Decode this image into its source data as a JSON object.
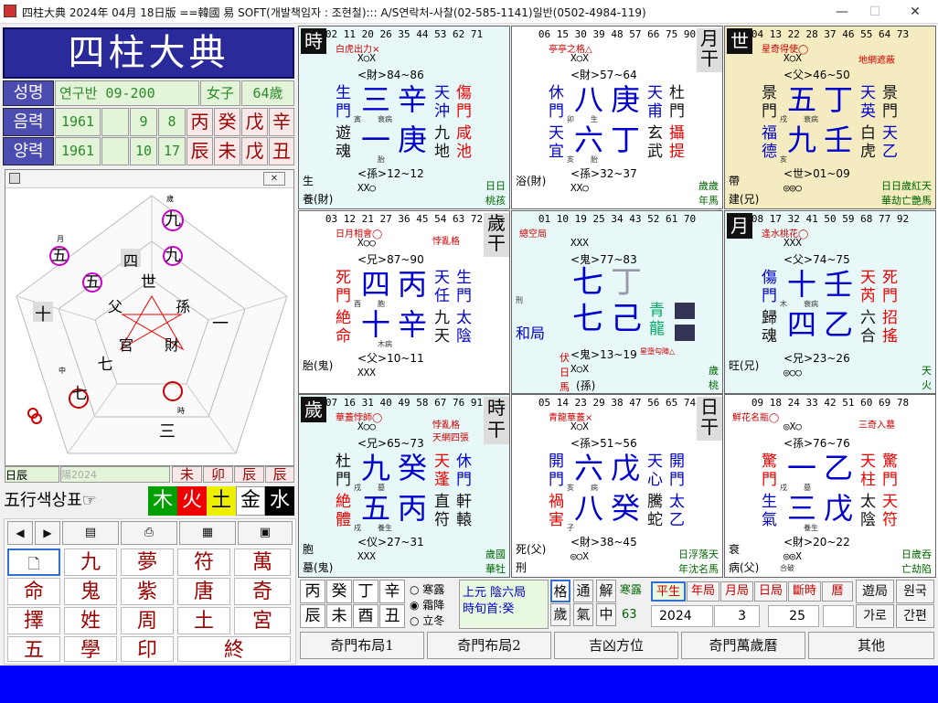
{
  "window": {
    "title": "四柱大典 2024年 04月 18日版 ==韓國 易 SOFT(개발책임자 : 조현철)::: A/S연락처-사찰(02-585-1141)일반(0502-4984-119)",
    "minimize": "—",
    "maximize": "☐",
    "close": "✕"
  },
  "logo": "四柱大典",
  "profile": {
    "name_label": "성명",
    "name": "연구반 09-200",
    "gender": "女子",
    "age": "64歲",
    "lunar_label": "음력",
    "lunar_year": "1961",
    "lunar_m": "9",
    "lunar_d": "8",
    "solar_label": "양력",
    "solar_year": "1961",
    "solar_m": "10",
    "solar_d": "17",
    "stems": [
      "丙",
      "癸",
      "戊",
      "辛"
    ],
    "branches": [
      "辰",
      "未",
      "戊",
      "丑"
    ]
  },
  "chart": {
    "rings": [
      "九",
      "九",
      "五",
      "五",
      "四",
      "十",
      "七",
      "七",
      "三",
      "一"
    ],
    "center": [
      "世",
      "父",
      "孫",
      "官",
      "財"
    ],
    "labels": [
      "歲",
      "月",
      "中",
      "時"
    ],
    "partial_date": "日辰",
    "partial_date2": "陽2024",
    "bottom_branches": [
      "未",
      "卯",
      "辰",
      "辰"
    ]
  },
  "elements": {
    "label": "五行색상표",
    "hand": "☞",
    "items": [
      "木",
      "火",
      "土",
      "金",
      "水"
    ]
  },
  "toolbar": {
    "prev": "◀",
    "next": "▶"
  },
  "grid_buttons": [
    "九",
    "夢",
    "符",
    "萬",
    "命",
    "鬼",
    "紫",
    "唐",
    "奇",
    "擇",
    "姓",
    "周",
    "土",
    "宮",
    "五",
    "學",
    "印",
    "終"
  ],
  "palaces": [
    {
      "tag": "時",
      "top": "02 11 20 26 35 44 53 62 71",
      "sub": "白虎出力×",
      "xo1": "X○X",
      "rel1": "<財>84~86",
      "l1": "生",
      "l2": "門",
      "l3": "遊",
      "l4": "魂",
      "b1": "三",
      "b2": "辛",
      "b3": "一",
      "b4": "庚",
      "t1": "寅",
      "t2": "衰病",
      "t3": "",
      "t4": "胎",
      "r1": "天",
      "r2": "沖",
      "r3": "九",
      "r4": "地",
      "rr1": "傷",
      "rr2": "門",
      "rr3": "咸",
      "rr4": "池",
      "rel2": "<孫>12~12",
      "xo2": "XX○",
      "bl": "生",
      "bl2": "養(財)",
      "br": "日日",
      "br2": "桃孩"
    },
    {
      "tag": "月干",
      "top": "06 15 30 39 48 57 66 75 90",
      "sub": "亭亭之格△",
      "xo1": "X○X",
      "rel1": "<財>57~64",
      "l1": "休",
      "l2": "門",
      "l3": "天",
      "l4": "宜",
      "b1": "八",
      "b2": "庚",
      "b3": "六",
      "b4": "丁",
      "t1": "卯",
      "t2": "生",
      "t3": "亥",
      "t4": "胎",
      "r1": "天",
      "r2": "甫",
      "r3": "玄",
      "r4": "武",
      "rr1": "杜",
      "rr2": "門",
      "rr3": "攝",
      "rr4": "提",
      "rel2": "<孫>32~37",
      "xo2": "XX○",
      "bl": "浴(財)",
      "bl2": "",
      "br": "歲歲",
      "br2": "年馬"
    },
    {
      "tag": "世",
      "top": "04 13 22 28 37 46 55 64 73",
      "sub": "星奇得使◯",
      "sub2": "地網遮蔽",
      "xo1": "X○X",
      "rel1": "<父>46~50",
      "l1": "景",
      "l2": "門",
      "l3": "福",
      "l4": "德",
      "b1": "五",
      "b2": "丁",
      "b3": "九",
      "b4": "壬",
      "t1": "戌",
      "t2": "衰病",
      "t3": "亥",
      "t4": "",
      "r1": "天",
      "r2": "英",
      "r3": "白",
      "r4": "虎",
      "rr1": "景",
      "rr2": "門",
      "rr3": "天",
      "rr4": "乙",
      "rel2": "<世>01~09",
      "xo2": "◎◎○",
      "bl": "帶",
      "bl2": "建(兄)",
      "br": "日日歲紅天",
      "br2": "華劫亡艷馬"
    },
    {
      "tag": "歲干",
      "top": "03 12 21 27 36 45 54 63 72",
      "sub": "日月相會◯",
      "sub2": "悖亂格",
      "xo1": "X○○",
      "rel1": "<兄>87~90",
      "l1": "死",
      "l2": "門",
      "l3": "絶",
      "l4": "命",
      "b1": "四",
      "b2": "丙",
      "b3": "十",
      "b4": "辛",
      "t1": "酉",
      "t2": "胞",
      "t3": "",
      "t4": "木病",
      "r1": "天",
      "r2": "任",
      "r3": "九",
      "r4": "天",
      "rr1": "生",
      "rr2": "門",
      "rr3": "太",
      "rr4": "陰",
      "rel2": "<父>10~11",
      "xo2": "XXX",
      "bl": "胎(鬼)",
      "bl2": "",
      "br": "",
      "br2": ""
    },
    {
      "tag": "",
      "top": "01 10 19 25 34 43 52 61 70",
      "sub": "總空局",
      "xo1": "XXX",
      "rel1": "<鬼>77~83",
      "b1": "七",
      "b2": "丁",
      "b3": "七",
      "b4": "己",
      "l1": "和局",
      "r1": "青",
      "r2": "龍",
      "rel2": "<鬼>13~19",
      "sub3": "星墮勾陣△",
      "xo2": "X○X",
      "bl": "伏日馬",
      "bl2": "(孫)",
      "br": "歲",
      "br2": "桃",
      "side": "刑"
    },
    {
      "tag": "月",
      "top": "08 17 32 41 50 59 68 77 92",
      "sub": "逢水桃花◯",
      "xo1": "XXX",
      "rel1": "<父>74~75",
      "l1": "傷",
      "l2": "門",
      "l3": "歸",
      "l4": "魂",
      "b1": "十",
      "b2": "壬",
      "b3": "四",
      "b4": "乙",
      "t1": "木",
      "t2": "衰病",
      "t3": "",
      "t4": "",
      "r1": "天",
      "r2": "芮",
      "r3": "六",
      "r4": "合",
      "rr1": "死",
      "rr2": "門",
      "rr3": "招",
      "rr4": "搖",
      "rel2": "<兄>23~26",
      "xo2": "◎○○",
      "bl": "旺(兄)",
      "bl2": "",
      "br": "天",
      "br2": "火"
    },
    {
      "tag": "歲",
      "tag2": "時干",
      "top": "07 16 31 40 49 58 67 76 91",
      "sub": "華蓋悖師◯",
      "sub2": "悖亂格",
      "sub3": "天網四張",
      "xo1": "X○○",
      "rel1": "<兄>65~73",
      "l1": "杜",
      "l2": "門",
      "l3": "絶",
      "l4": "體",
      "b1": "九",
      "b2": "癸",
      "b3": "五",
      "b4": "丙",
      "t1": "戌",
      "t2": "墓",
      "t3": "戌",
      "t4": "養生",
      "r1": "天",
      "r2": "蓬",
      "r3": "直",
      "r4": "符",
      "rr1": "休",
      "rr2": "門",
      "rr3": "軒",
      "rr4": "轅",
      "rel2": "<仪>27~31",
      "xo2": "XXX",
      "bl": "胞",
      "bl2": "墓(鬼)",
      "br": "歲國",
      "br2": "華牡"
    },
    {
      "tag": "日干",
      "top": "05 14 23 29 38 47 56 65 74",
      "sub": "青龍華蓋×",
      "xo1": "X○X",
      "rel1": "<孫>51~56",
      "l1": "開",
      "l2": "門",
      "l3": "禍",
      "l4": "害",
      "b1": "六",
      "b2": "戊",
      "b3": "八",
      "b4": "癸",
      "t1": "亥",
      "t2": "病",
      "t3": "子",
      "t4": "",
      "r1": "天",
      "r2": "心",
      "r3": "騰",
      "r4": "蛇",
      "rr1": "開",
      "rr2": "門",
      "rr3": "太",
      "rr4": "乙",
      "rel2": "<財>38~45",
      "xo2": "◎○X",
      "bl": "死(父)",
      "bl2": "刑",
      "br": "日浮落天",
      "br2": "年沈名馬"
    },
    {
      "tag": "",
      "top": "09 18 24 33 42 51 60 69 78",
      "sub": "鮮花名瓶◯",
      "sub2": "三奇入墓",
      "xo1": "◎X○",
      "rel1": "<孫>76~76",
      "l1": "驚",
      "l2": "門",
      "l3": "生",
      "l4": "氣",
      "b1": "一",
      "b2": "乙",
      "b3": "三",
      "b4": "戊",
      "t1": "戌",
      "t2": "墓",
      "t3": "",
      "t4": "養生",
      "r1": "天",
      "r2": "柱",
      "r3": "太",
      "r4": "陰",
      "rr1": "驚",
      "rr2": "門",
      "rr3": "天",
      "rr4": "符",
      "rel2": "<財>20~22",
      "xo2": "◎◎X",
      "bl": "衰",
      "bl2": "病(父)",
      "br": "日歲吞",
      "br2": "亡劫陷",
      "side": "合破"
    }
  ],
  "bottom": {
    "stems": [
      "丙",
      "癸",
      "丁",
      "辛"
    ],
    "branches": [
      "辰",
      "未",
      "酉",
      "丑"
    ],
    "radio": [
      "寒露",
      "霜降",
      "立冬"
    ],
    "ju1": "上元 陰六局",
    "ju2": "時旬首:癸",
    "m1": [
      "格",
      "通",
      "解"
    ],
    "m2": [
      "歲",
      "氣",
      "中"
    ],
    "cold": "寒露",
    "cold_n": "63",
    "tabs": [
      "平生",
      "年局",
      "月局",
      "日局",
      "斷時",
      "曆"
    ],
    "year": "2024",
    "month": "3",
    "day": "25",
    "right1": [
      "遊局",
      "원국"
    ],
    "right2": [
      "가로",
      "간편"
    ],
    "menu": [
      "奇門布局1",
      "奇門布局2",
      "吉凶方位",
      "奇門萬歲曆",
      "其他"
    ]
  }
}
